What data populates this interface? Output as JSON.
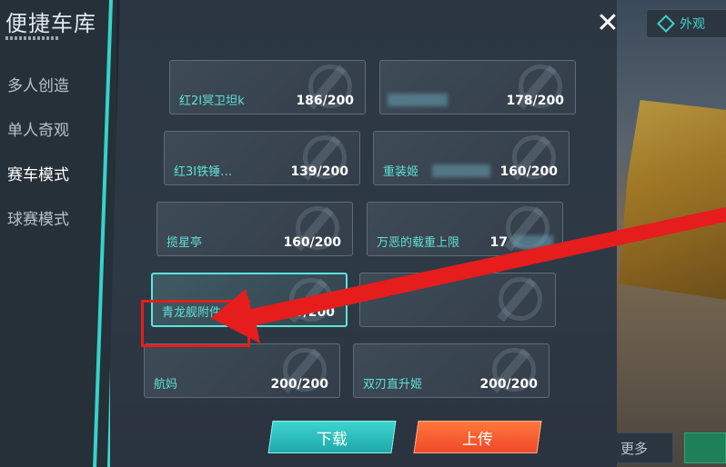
{
  "sidebar": {
    "title": "便捷车库",
    "items": [
      {
        "label": "多人创造",
        "active": false
      },
      {
        "label": "单人奇观",
        "active": false
      },
      {
        "label": "赛车模式",
        "active": true
      },
      {
        "label": "球赛模式",
        "active": false
      }
    ]
  },
  "close": {
    "glyph": "✕"
  },
  "cards": [
    {
      "name": "红2I冥卫坦k",
      "count": "186/200",
      "selected": false
    },
    {
      "name": "",
      "count": "178/200",
      "selected": false
    },
    {
      "name": "红3I铁锤…",
      "count": "139/200",
      "selected": false
    },
    {
      "name": "重装姬",
      "count": "160/200",
      "selected": false
    },
    {
      "name": "揽星亭",
      "count": "160/200",
      "selected": false
    },
    {
      "name": "万恶的载重上限",
      "count": "17",
      "selected": false
    },
    {
      "name": "青龙舰附件",
      "count": "169/200",
      "selected": true
    },
    {
      "name": "",
      "count": "",
      "selected": false
    },
    {
      "name": "航妈",
      "count": "200/200",
      "selected": false
    },
    {
      "name": "双刃直升姬",
      "count": "200/200",
      "selected": false
    }
  ],
  "buttons": {
    "download": "下载",
    "upload": "上传"
  },
  "background": {
    "top_pill_label": "外观",
    "more_label": "更多"
  },
  "colors": {
    "accent": "#3ed7cf",
    "upload": "#f0462a",
    "annotation": "#e51d1d"
  }
}
